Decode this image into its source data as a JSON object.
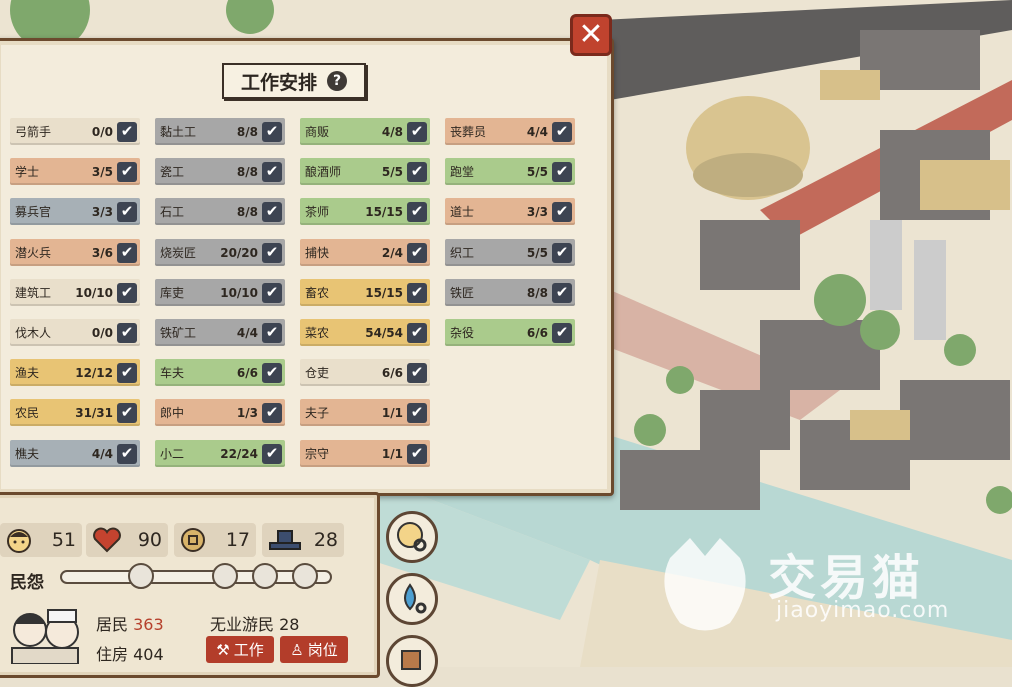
{
  "panel": {
    "title": "工作安排",
    "help_icon": "?",
    "close_icon": "✕",
    "check_mark": "✔",
    "columns": [
      [
        {
          "name": "弓箭手",
          "count": "0/0",
          "color": "#e9dfcb"
        },
        {
          "name": "学士",
          "count": "3/5",
          "color": "#e3b593"
        },
        {
          "name": "募兵官",
          "count": "3/3",
          "color": "#a7b0b6"
        },
        {
          "name": "潜火兵",
          "count": "3/6",
          "color": "#e3b593"
        },
        {
          "name": "建筑工",
          "count": "10/10",
          "color": "#e9dfcb"
        },
        {
          "name": "伐木人",
          "count": "0/0",
          "color": "#e9dfcb"
        },
        {
          "name": "渔夫",
          "count": "12/12",
          "color": "#e8c474"
        },
        {
          "name": "农民",
          "count": "31/31",
          "color": "#e8c474"
        },
        {
          "name": "樵夫",
          "count": "4/4",
          "color": "#a7b0b6"
        }
      ],
      [
        {
          "name": "黏土工",
          "count": "8/8",
          "color": "#a7a7a7"
        },
        {
          "name": "瓷工",
          "count": "8/8",
          "color": "#a7a7a7"
        },
        {
          "name": "石工",
          "count": "8/8",
          "color": "#a7a7a7"
        },
        {
          "name": "烧炭匠",
          "count": "20/20",
          "color": "#a7a7a7"
        },
        {
          "name": "库吏",
          "count": "10/10",
          "color": "#a7a7a7"
        },
        {
          "name": "铁矿工",
          "count": "4/4",
          "color": "#a7a7a7"
        },
        {
          "name": "车夫",
          "count": "6/6",
          "color": "#aacb8c"
        },
        {
          "name": "郎中",
          "count": "1/3",
          "color": "#e3b593"
        },
        {
          "name": "小二",
          "count": "22/24",
          "color": "#aacb8c"
        }
      ],
      [
        {
          "name": "商贩",
          "count": "4/8",
          "color": "#aacb8c"
        },
        {
          "name": "酿酒师",
          "count": "5/5",
          "color": "#aacb8c"
        },
        {
          "name": "茶师",
          "count": "15/15",
          "color": "#aacb8c"
        },
        {
          "name": "捕快",
          "count": "2/4",
          "color": "#e3b593"
        },
        {
          "name": "畜农",
          "count": "15/15",
          "color": "#e8c474"
        },
        {
          "name": "菜农",
          "count": "54/54",
          "color": "#e8c474"
        },
        {
          "name": "仓吏",
          "count": "6/6",
          "color": "#e9dfcb"
        },
        {
          "name": "夫子",
          "count": "1/1",
          "color": "#e3b593"
        },
        {
          "name": "宗守",
          "count": "1/1",
          "color": "#e3b593"
        }
      ],
      [
        {
          "name": "丧葬员",
          "count": "4/4",
          "color": "#e3b593"
        },
        {
          "name": "跑堂",
          "count": "5/5",
          "color": "#aacb8c"
        },
        {
          "name": "道士",
          "count": "3/3",
          "color": "#e3b593"
        },
        {
          "name": "织工",
          "count": "5/5",
          "color": "#a7a7a7"
        },
        {
          "name": "铁匠",
          "count": "8/8",
          "color": "#a7a7a7"
        },
        {
          "name": "杂役",
          "count": "6/6",
          "color": "#aacb8c"
        }
      ]
    ]
  },
  "stats": {
    "population_happy": "51",
    "health": "90",
    "coins": "17",
    "officials": "28",
    "mood_label": "民怨",
    "residents_label": "居民",
    "residents": "363",
    "unemployed_label": "无业游民",
    "unemployed": "28",
    "housing_label": "住房",
    "housing": "404",
    "work_button": "工作",
    "post_button": "岗位"
  },
  "watermark": {
    "text": "交易猫",
    "url": "jiaoyimao.com"
  },
  "colors": {
    "close": "#c0432e",
    "check": "#3d4452",
    "accent_red": "#b33d2a"
  }
}
